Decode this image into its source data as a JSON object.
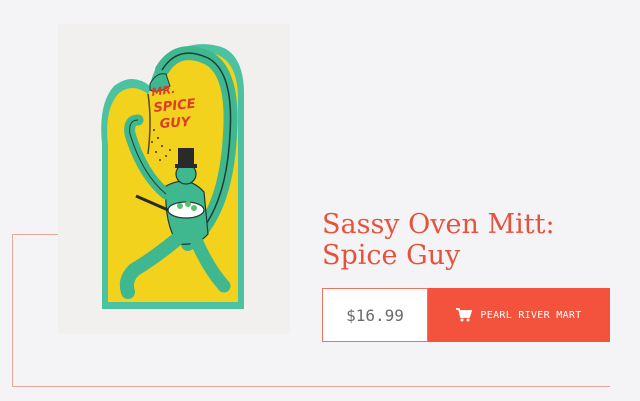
{
  "product": {
    "title": "Sassy Oven Mitt: Spice Guy",
    "price": "$16.99",
    "buy_button_label": "PEARL RIVER MART",
    "image_text": "MR. SPICE GUY",
    "image_alt": "Oven mitt printed with Mr. Spice Guy illustration"
  },
  "colors": {
    "accent": "#f3533c",
    "title": "#e5533c",
    "mitt_yellow": "#f2d21c",
    "mitt_teal": "#4cc2a0",
    "background": "#f4f4f6"
  },
  "icons": {
    "buy_button": "shopping-cart-icon"
  }
}
